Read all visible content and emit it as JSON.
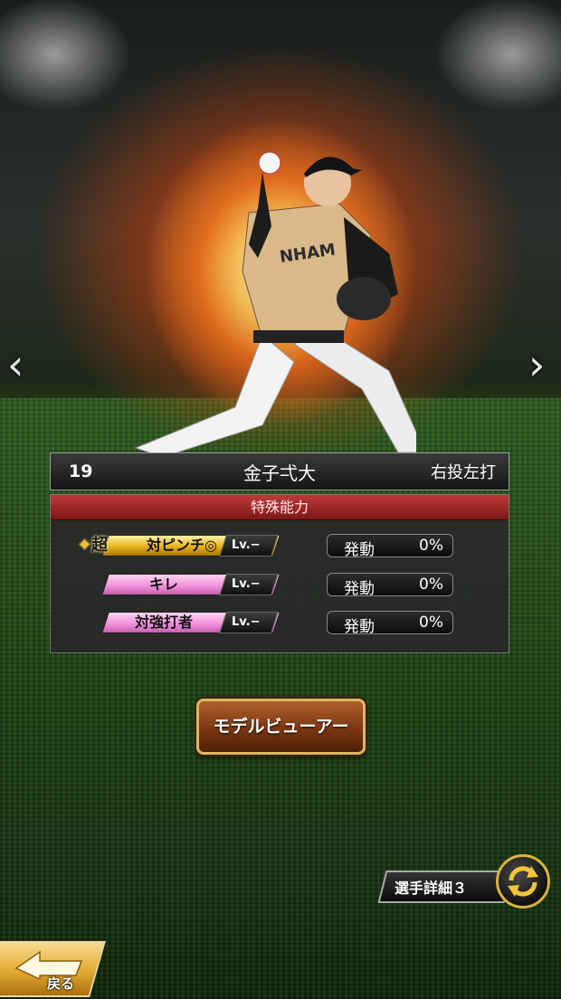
{
  "player": {
    "number": "19",
    "name": "金子弌大",
    "throw_bat": "右投左打"
  },
  "abilities": {
    "title": "特殊能力",
    "items": [
      {
        "tier": "超",
        "name": "対ピンチ◎",
        "level": "Lv.−",
        "status": "発動",
        "rate": "0%",
        "color": "#e8b21c"
      },
      {
        "tier": "",
        "name": "キレ",
        "level": "Lv.−",
        "status": "発動",
        "rate": "0%",
        "color": "#f08ed8"
      },
      {
        "tier": "",
        "name": "対強打者",
        "level": "Lv.−",
        "status": "発動",
        "rate": "0%",
        "color": "#f08ed8"
      }
    ]
  },
  "buttons": {
    "model_viewer": "モデルビューアー",
    "detail": "選手詳細３",
    "back": "戻る"
  },
  "icons": {
    "prev": "chevron-left-icon",
    "next": "chevron-right-icon",
    "switch": "rotate-arrows-icon",
    "back": "back-arrow-icon"
  }
}
